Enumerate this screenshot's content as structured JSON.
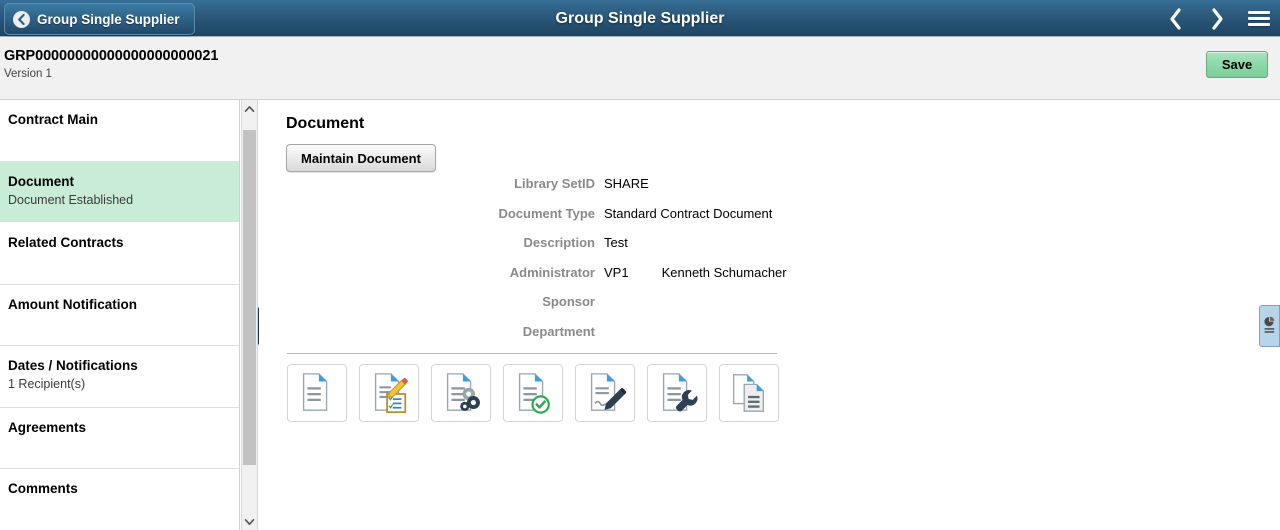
{
  "header": {
    "back_label": "Group Single Supplier",
    "title": "Group Single Supplier",
    "prev_icon": "chevron-left-icon",
    "next_icon": "chevron-right-icon",
    "menu_icon": "hamburger-menu-icon"
  },
  "subheader": {
    "document_id": "GRP00000000000000000000021",
    "version": "Version 1",
    "save_label": "Save"
  },
  "sidebar": {
    "items": [
      {
        "label": "Contract Main",
        "sub": "",
        "selected": false
      },
      {
        "label": "Document",
        "sub": "Document Established",
        "selected": true
      },
      {
        "label": "Related Contracts",
        "sub": "",
        "selected": false
      },
      {
        "label": "Amount Notification",
        "sub": "",
        "selected": false
      },
      {
        "label": "Dates / Notifications",
        "sub": "1 Recipient(s)",
        "selected": false
      },
      {
        "label": "Agreements",
        "sub": "",
        "selected": false
      },
      {
        "label": "Comments",
        "sub": "",
        "selected": false
      }
    ],
    "scroll_up_icon": "chevron-up-icon",
    "scroll_down_icon": "chevron-down-icon"
  },
  "splitter": {
    "icon": "collapse-panel-icon"
  },
  "main": {
    "panel_title": "Document",
    "maintain_button": "Maintain Document",
    "fields": [
      {
        "label": "Library SetID",
        "value": "SHARE",
        "value2": ""
      },
      {
        "label": "Document Type",
        "value": "Standard Contract Document",
        "value2": ""
      },
      {
        "label": "Description",
        "value": "Test",
        "value2": ""
      },
      {
        "label": "Administrator",
        "value": "VP1",
        "value2": "Kenneth Schumacher"
      },
      {
        "label": "Sponsor",
        "value": "",
        "value2": ""
      },
      {
        "label": "Department",
        "value": "",
        "value2": ""
      }
    ],
    "action_icons": [
      "document-view-icon",
      "document-edit-icon",
      "document-settings-icon",
      "document-approved-icon",
      "document-sign-icon",
      "document-configure-icon",
      "document-copy-icon"
    ]
  },
  "right_tab": {
    "icon": "report-chart-icon"
  },
  "colors": {
    "header_blue": "#2d5d80",
    "selected_green": "#c9ecd6",
    "save_green": "#8ed8a9",
    "label_gray": "#8a8a8a",
    "subheader_gray": "#f1f1f1"
  }
}
